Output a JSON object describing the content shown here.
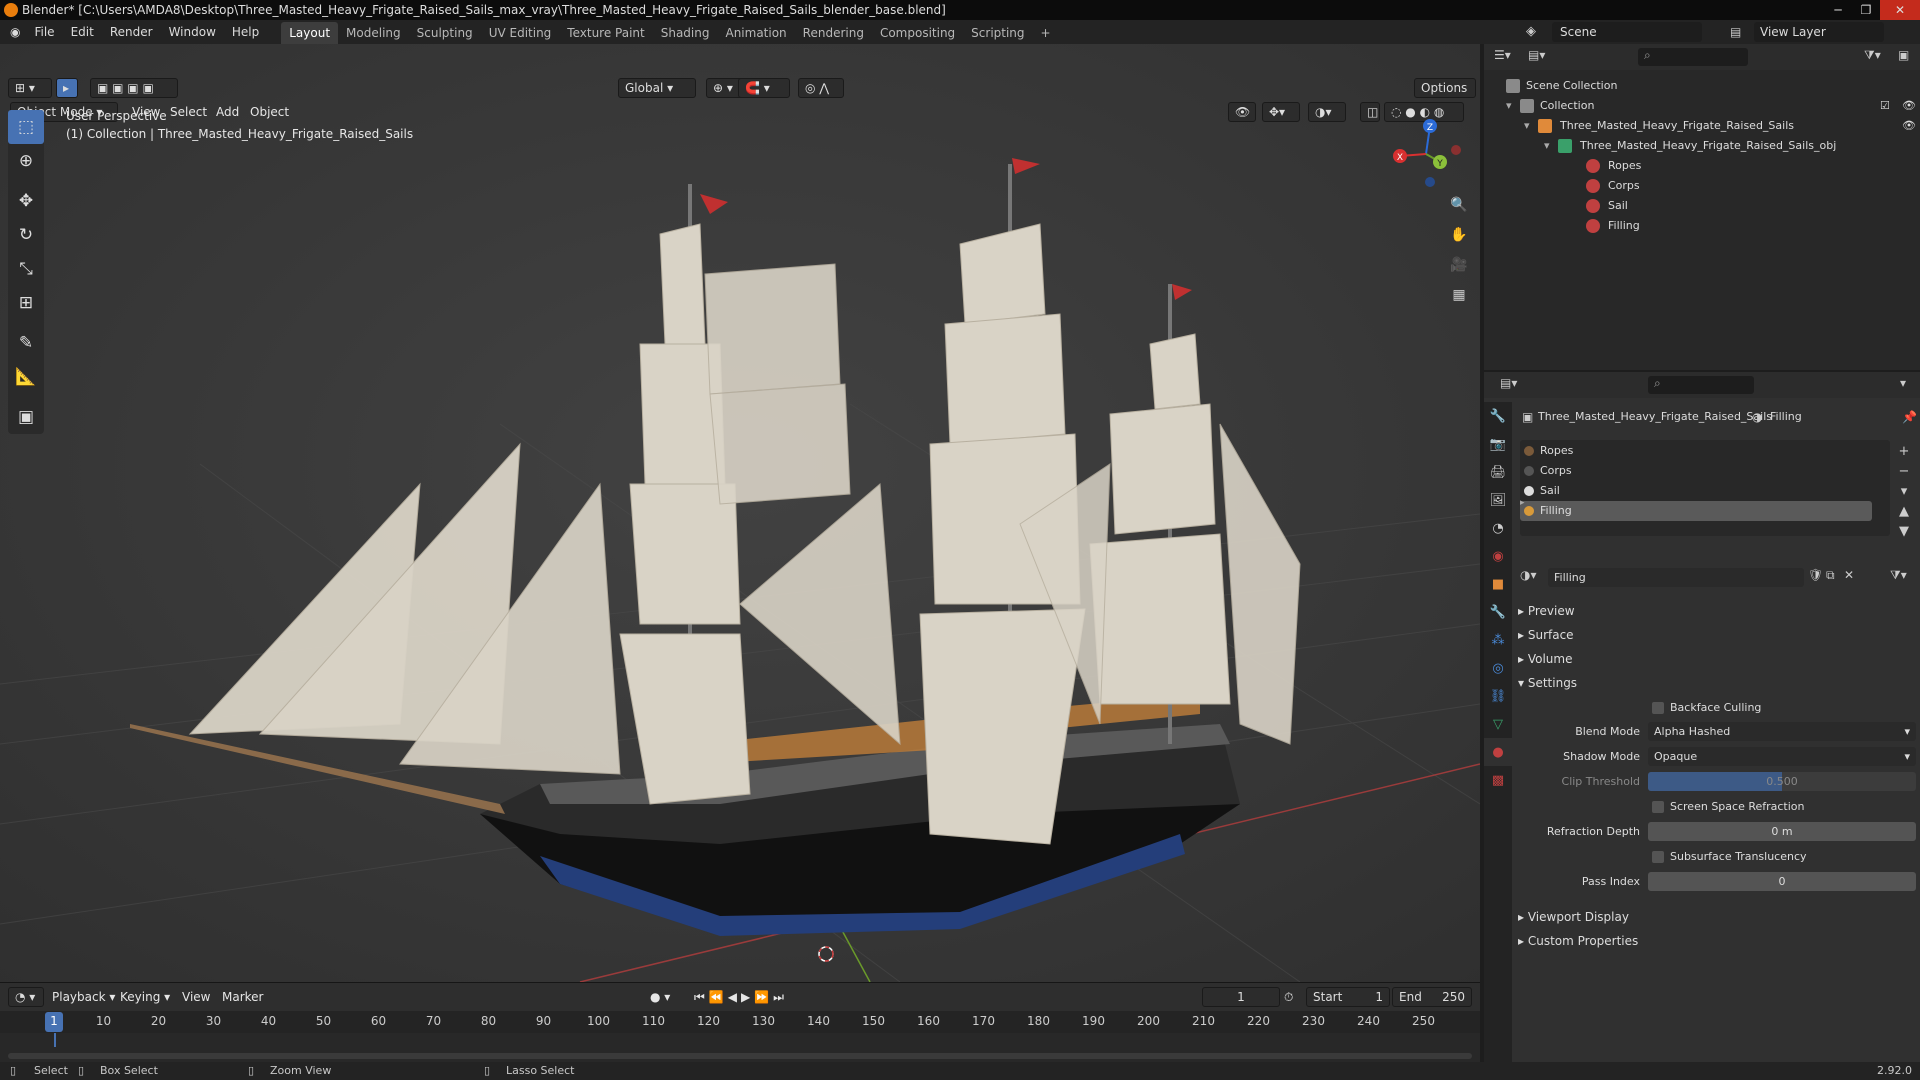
{
  "window": {
    "title": "Blender* [C:\\Users\\AMDA8\\Desktop\\Three_Masted_Heavy_Frigate_Raised_Sails_max_vray\\Three_Masted_Heavy_Frigate_Raised_Sails_blender_base.blend]",
    "controls": [
      "─",
      "❐",
      "✕"
    ]
  },
  "menu": [
    "File",
    "Edit",
    "Render",
    "Window",
    "Help"
  ],
  "workspaces": [
    "Layout",
    "Modeling",
    "Sculpting",
    "UV Editing",
    "Texture Paint",
    "Shading",
    "Animation",
    "Rendering",
    "Compositing",
    "Scripting",
    "+"
  ],
  "scene": {
    "name": "Scene",
    "view_layer": "View Layer"
  },
  "viewport": {
    "mode": "Object Mode",
    "menus": [
      "View",
      "Select",
      "Add",
      "Object"
    ],
    "transform_orientation": "Global",
    "options_label": "Options",
    "overlay_line1": "User Perspective",
    "overlay_line2": "(1) Collection | Three_Masted_Heavy_Frigate_Raised_Sails",
    "gizmo": {
      "x": "X",
      "y": "Y",
      "z": "Z"
    }
  },
  "timeline": {
    "menus": [
      "Playback",
      "Keying",
      "View",
      "Marker"
    ],
    "current_frame": "1",
    "start_label": "Start",
    "start": "1",
    "end_label": "End",
    "end": "250",
    "ticks": [
      "1",
      "10",
      "20",
      "30",
      "40",
      "50",
      "60",
      "70",
      "80",
      "90",
      "100",
      "110",
      "120",
      "130",
      "140",
      "150",
      "160",
      "170",
      "180",
      "190",
      "200",
      "210",
      "220",
      "230",
      "240",
      "250"
    ]
  },
  "statusbar": {
    "select": "Select",
    "box_select": "Box Select",
    "zoom_view": "Zoom View",
    "lasso_select": "Lasso Select",
    "version": "2.92.0"
  },
  "outliner": {
    "rows": [
      {
        "label": "Scene Collection",
        "indent": 0
      },
      {
        "label": "Collection",
        "indent": 1
      },
      {
        "label": "Three_Masted_Heavy_Frigate_Raised_Sails",
        "indent": 2
      },
      {
        "label": "Three_Masted_Heavy_Frigate_Raised_Sails_obj",
        "indent": 3
      },
      {
        "label": "Ropes",
        "indent": 4
      },
      {
        "label": "Corps",
        "indent": 4
      },
      {
        "label": "Sail",
        "indent": 4
      },
      {
        "label": "Filling",
        "indent": 4
      }
    ]
  },
  "properties": {
    "object_name": "Three_Masted_Heavy_Frigate_Raised_Sails",
    "material_name": "Filling",
    "slots": [
      "Ropes",
      "Corps",
      "Sail",
      "Filling"
    ],
    "active_slot": "Filling",
    "material_field": "Filling",
    "panels": {
      "preview": "Preview",
      "surface": "Surface",
      "volume": "Volume",
      "settings": "Settings",
      "viewport_display": "Viewport Display",
      "custom_properties": "Custom Properties"
    },
    "settings": {
      "backface_culling": "Backface Culling",
      "blend_mode_label": "Blend Mode",
      "blend_mode": "Alpha Hashed",
      "shadow_mode_label": "Shadow Mode",
      "shadow_mode": "Opaque",
      "clip_threshold_label": "Clip Threshold",
      "clip_threshold": "0.500",
      "screen_space_refraction": "Screen Space Refraction",
      "refraction_depth_label": "Refraction Depth",
      "refraction_depth": "0 m",
      "subsurface_translucency": "Subsurface Translucency",
      "pass_index_label": "Pass Index",
      "pass_index": "0"
    }
  },
  "colors": {
    "accent": "#4772b3",
    "active_workspace": "#3d3d3d",
    "viewport_bg": "#3a3a3a"
  }
}
